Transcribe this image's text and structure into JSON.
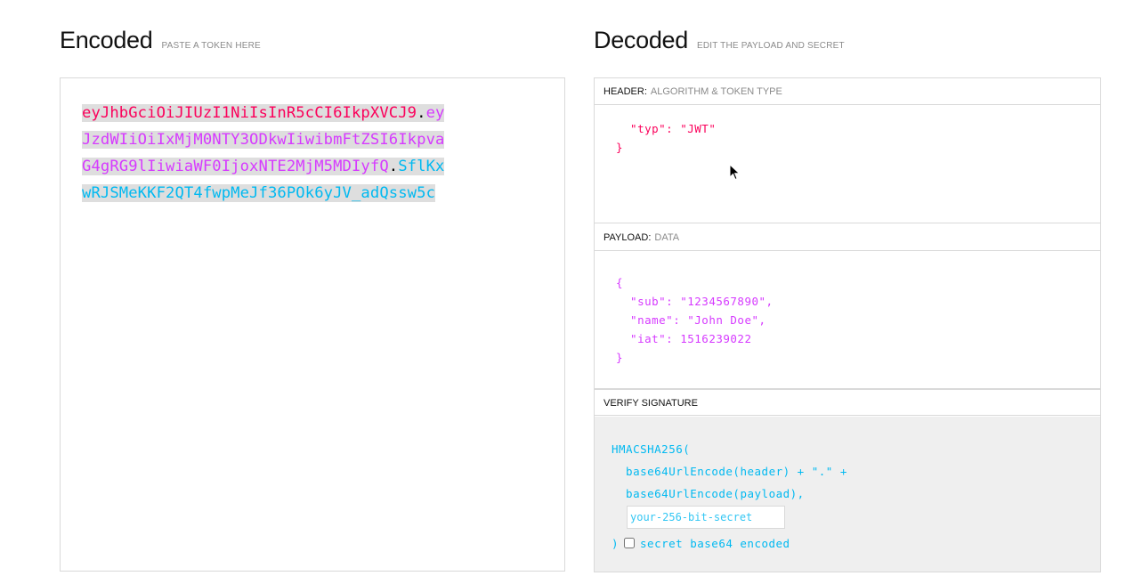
{
  "encoded": {
    "title": "Encoded",
    "subtitle": "PASTE A TOKEN HERE",
    "token_lines": [
      [
        {
          "t": "eyJhbGciOiJIUzI1NiIsInR5cCI6IkpXVCJ9",
          "c": "h"
        },
        {
          "t": ".",
          "c": "d"
        },
        {
          "t": "ey",
          "c": "p"
        }
      ],
      [
        {
          "t": "JzdWIiOiIxMjM0NTY3ODkwIiwibmFtZSI6Ikpva",
          "c": "p"
        }
      ],
      [
        {
          "t": "G4gRG9lIiwiaWF0IjoxNTE2MjM5MDIyfQ",
          "c": "p"
        },
        {
          "t": ".",
          "c": "d"
        },
        {
          "t": "SflKx",
          "c": "s"
        }
      ],
      [
        {
          "t": "wRJSMeKKF2QT4fwpMeJf36POk6yJV_adQssw5c",
          "c": "s"
        }
      ]
    ]
  },
  "decoded": {
    "title": "Decoded",
    "subtitle": "EDIT THE PAYLOAD AND SECRET",
    "header": {
      "label": "HEADER:",
      "desc": "ALGORITHM & TOKEN TYPE",
      "lines": [
        "  \"typ\": \"JWT\"",
        "}"
      ]
    },
    "payload": {
      "label": "PAYLOAD:",
      "desc": "DATA",
      "lines": [
        "{",
        "  \"sub\": \"1234567890\",",
        "  \"name\": \"John Doe\",",
        "  \"iat\": 1516239022",
        "}"
      ]
    },
    "verify": {
      "label": "VERIFY SIGNATURE",
      "lines": [
        "HMACSHA256(",
        "  base64UrlEncode(header) + \".\" +",
        "  base64UrlEncode(payload),"
      ],
      "secret_placeholder": "your-256-bit-secret",
      "close": ")",
      "checkbox_label": "secret base64 encoded"
    }
  },
  "colors": {
    "header": "#fb015b",
    "payload": "#d63aff",
    "signature": "#00b9f1"
  }
}
